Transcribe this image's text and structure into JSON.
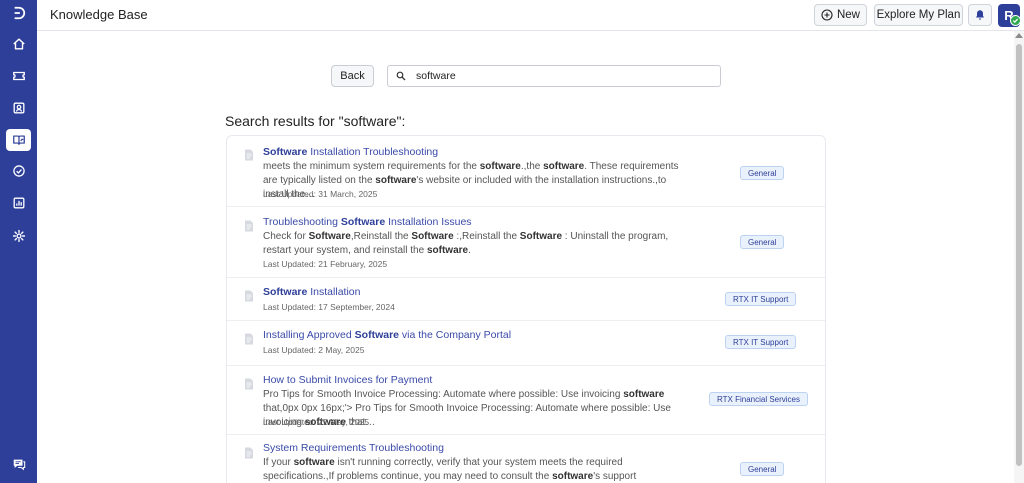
{
  "header": {
    "title": "Knowledge Base",
    "new_label": "New",
    "plan_label": "Explore My Plan",
    "avatar_initial": "R"
  },
  "sidebar": {
    "items": [
      {
        "icon": "home-icon"
      },
      {
        "icon": "ticket-icon"
      },
      {
        "icon": "contacts-icon"
      },
      {
        "icon": "knowledge-base-icon",
        "active": true
      },
      {
        "icon": "tasks-check-icon"
      },
      {
        "icon": "reports-icon"
      },
      {
        "icon": "settings-gear-icon"
      }
    ],
    "bottom_icon": "chat-icon"
  },
  "search": {
    "back_label": "Back",
    "value": "software"
  },
  "results_heading": "Search results for \"software\":",
  "results": [
    {
      "title_parts": [
        {
          "t": "Software",
          "b": true
        },
        {
          "t": " Installation Troubleshooting",
          "b": false
        }
      ],
      "snippet_parts": [
        {
          "t": "meets the minimum system requirements for the ",
          "b": false
        },
        {
          "t": "software",
          "b": true
        },
        {
          "t": ".,the ",
          "b": false
        },
        {
          "t": "software",
          "b": true
        },
        {
          "t": ". These requirements are typically listed on the ",
          "b": false
        },
        {
          "t": "software",
          "b": true
        },
        {
          "t": "'s website or included with the installation instructions.,to install the…",
          "b": false
        }
      ],
      "date": "Last Updated: 31 March, 2025",
      "badge": "General"
    },
    {
      "title_parts": [
        {
          "t": "Troubleshooting ",
          "b": false
        },
        {
          "t": "Software",
          "b": true
        },
        {
          "t": " Installation Issues",
          "b": false
        }
      ],
      "snippet_parts": [
        {
          "t": "Check for ",
          "b": false
        },
        {
          "t": "Software",
          "b": true
        },
        {
          "t": ",Reinstall the ",
          "b": false
        },
        {
          "t": "Software",
          "b": true
        },
        {
          "t": " :,Reinstall the ",
          "b": false
        },
        {
          "t": "Software",
          "b": true
        },
        {
          "t": " : Uninstall the program, restart your system, and reinstall the ",
          "b": false
        },
        {
          "t": "software",
          "b": true
        },
        {
          "t": ".",
          "b": false
        }
      ],
      "date": "Last Updated: 21 February, 2025",
      "badge": "General"
    },
    {
      "title_parts": [
        {
          "t": "Software",
          "b": true
        },
        {
          "t": " Installation",
          "b": false
        }
      ],
      "snippet_parts": [],
      "date": "Last Updated: 17 September, 2024",
      "badge": "RTX IT Support"
    },
    {
      "title_parts": [
        {
          "t": "Installing Approved ",
          "b": false
        },
        {
          "t": "Software",
          "b": true
        },
        {
          "t": " via the Company Portal",
          "b": false
        }
      ],
      "snippet_parts": [],
      "date": "Last Updated: 2 May, 2025",
      "badge": "RTX IT Support"
    },
    {
      "title_parts": [
        {
          "t": "How to Submit Invoices for Payment",
          "b": false
        }
      ],
      "snippet_parts": [
        {
          "t": "Pro Tips for Smooth Invoice Processing: Automate where possible: Use invoicing ",
          "b": false
        },
        {
          "t": "software",
          "b": true
        },
        {
          "t": " that,0px 0px 16px;'> Pro Tips for Smooth Invoice Processing: Automate where possible: Use invoicing ",
          "b": false
        },
        {
          "t": "software",
          "b": true
        },
        {
          "t": " that…",
          "b": false
        }
      ],
      "date": "Last Updated: 22 May, 2025",
      "badge": "RTX Financial Services"
    },
    {
      "title_parts": [
        {
          "t": "System Requirements Troubleshooting",
          "b": false
        }
      ],
      "snippet_parts": [
        {
          "t": "If your ",
          "b": false
        },
        {
          "t": "software",
          "b": true
        },
        {
          "t": " isn't running correctly, verify that your system meets the required specifications.,If problems continue, you may need to consult the ",
          "b": false
        },
        {
          "t": "software",
          "b": true
        },
        {
          "t": "'s support documentation for specific,If…",
          "b": false
        }
      ],
      "date": "",
      "badge": "General"
    }
  ]
}
